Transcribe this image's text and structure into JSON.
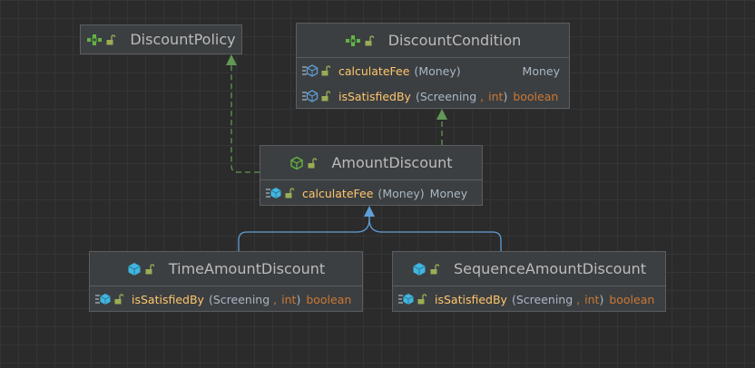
{
  "colors": {
    "background": "#2b2b2b",
    "node_fill": "#3c3f41",
    "node_border": "#5b5d60",
    "realization_edge": "#629755",
    "inheritance_edge": "#5f9ed6",
    "interface_icon": "#62b543",
    "class_icon": "#40b6e0",
    "method_name": "#ffc66d",
    "keyword": "#cc7832"
  },
  "nodes": {
    "discount_policy": {
      "name": "DiscountPolicy",
      "kind": "interface",
      "icon": "interface-icon"
    },
    "discount_condition": {
      "name": "DiscountCondition",
      "kind": "interface",
      "icon": "interface-icon",
      "methods": [
        {
          "name": "calculateFee",
          "open": "(",
          "params": [
            "Money"
          ],
          "close": ")",
          "returns": "Money"
        },
        {
          "name": "isSatisfiedBy",
          "open": "(",
          "params": [
            "Screening",
            "int"
          ],
          "close": ")",
          "returns": "boolean"
        }
      ]
    },
    "amount_discount": {
      "name": "AmountDiscount",
      "kind": "abstract-class",
      "icon": "abstract-class-icon",
      "methods": [
        {
          "name": "calculateFee",
          "open": "(",
          "params": [
            "Money"
          ],
          "close": ")",
          "returns": "Money"
        }
      ]
    },
    "time_amount_discount": {
      "name": "TimeAmountDiscount",
      "kind": "class",
      "icon": "class-icon",
      "methods": [
        {
          "name": "isSatisfiedBy",
          "open": "(",
          "params": [
            "Screening",
            "int"
          ],
          "close": ")",
          "returns": "boolean"
        }
      ]
    },
    "sequence_amount_discount": {
      "name": "SequenceAmountDiscount",
      "kind": "class",
      "icon": "class-icon",
      "methods": [
        {
          "name": "isSatisfiedBy",
          "open": "(",
          "params": [
            "Screening",
            "int"
          ],
          "close": ")",
          "returns": "boolean"
        }
      ]
    }
  },
  "edges": [
    {
      "from": "AmountDiscount",
      "to": "DiscountPolicy",
      "type": "implements",
      "style": "dashed"
    },
    {
      "from": "AmountDiscount",
      "to": "DiscountCondition",
      "type": "implements",
      "style": "dashed"
    },
    {
      "from": "TimeAmountDiscount",
      "to": "AmountDiscount",
      "type": "extends",
      "style": "solid"
    },
    {
      "from": "SequenceAmountDiscount",
      "to": "AmountDiscount",
      "type": "extends",
      "style": "solid"
    }
  ]
}
